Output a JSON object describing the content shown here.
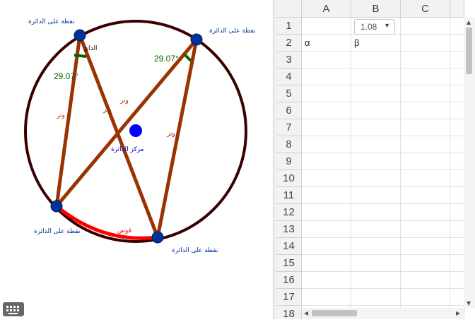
{
  "graphics": {
    "point_label": "نقطة على الدائرة",
    "center_label": "مركز الدائرة",
    "chord_label": "وتر",
    "arc_label": "قوس",
    "angle_value": "29.07°",
    "partial_label": "الدائ",
    "colors": {
      "circle": "#3a0000",
      "chord": "#993300",
      "arc": "#ff0000",
      "point": "#003399",
      "center": "#0000ff",
      "angle": "#006400"
    }
  },
  "spreadsheet": {
    "columns": [
      "A",
      "B",
      "C"
    ],
    "rows": [
      "1",
      "2",
      "3",
      "4",
      "5",
      "6",
      "7",
      "8",
      "9",
      "10",
      "11",
      "12",
      "13",
      "14",
      "15",
      "16",
      "17",
      "18"
    ],
    "slider_value": "1.08",
    "cell_A2": "α",
    "cell_B2": "β"
  },
  "keyboard_icon": "keyboard-icon"
}
